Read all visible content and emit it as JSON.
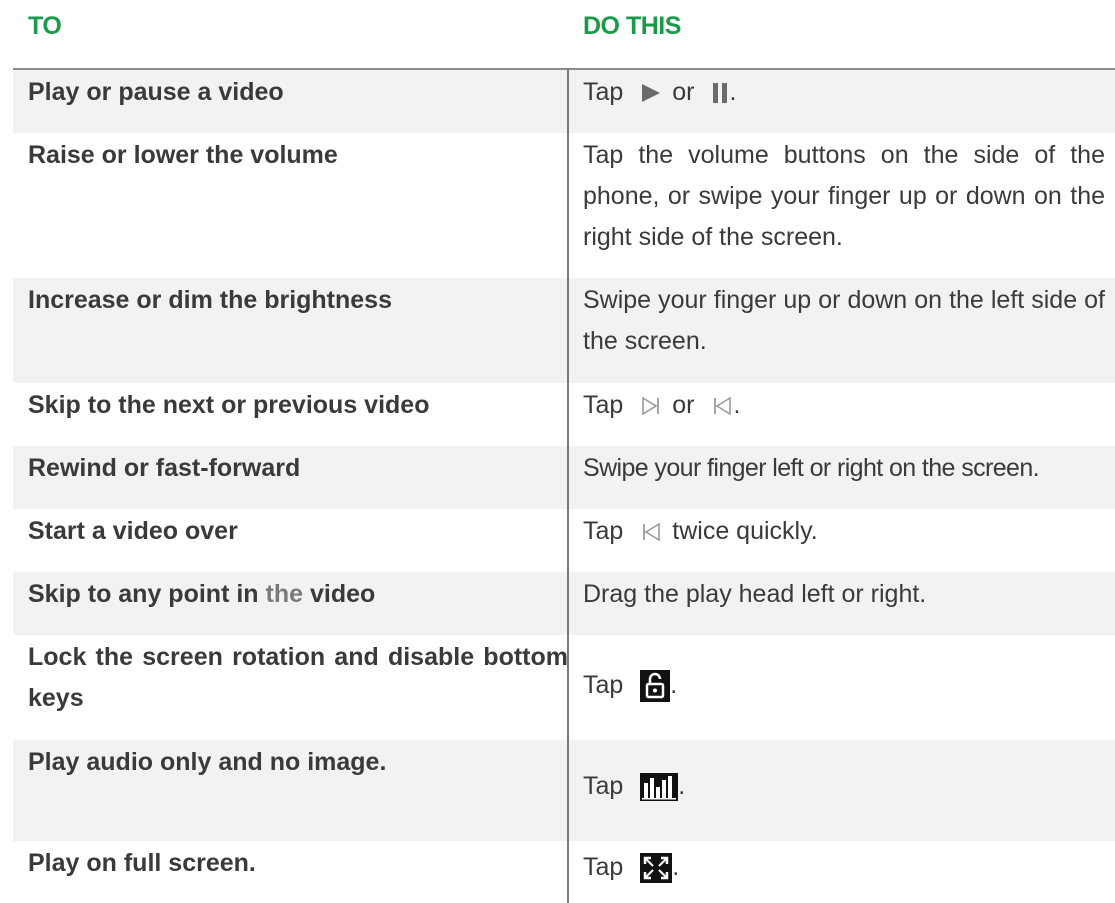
{
  "header": {
    "to": "TO",
    "do_this": "DO THIS",
    "color": "#1a9a4a"
  },
  "rows": [
    {
      "to": "Play or pause a video",
      "tap": "Tap",
      "mid": "or",
      "end": "."
    },
    {
      "to": "Raise or lower the volume",
      "do": "Tap the volume buttons on the side of the phone, or swipe your finger up or down on the right side of the screen."
    },
    {
      "to": "Increase or dim the brightness",
      "do": "Swipe your finger up or down on the left side of the screen."
    },
    {
      "to": "Skip to the next or previous video",
      "tap": "Tap",
      "mid": "or",
      "end": "."
    },
    {
      "to": "Rewind or fast-forward",
      "do": "Swipe your finger left or right on the screen."
    },
    {
      "to": "Start a video over",
      "tap": "Tap",
      "end": "twice quickly."
    },
    {
      "to_a": "Skip to any point in",
      "to_b": "the",
      "to_c": "video",
      "do": "Drag the play head left or right."
    },
    {
      "to": "Lock the screen rotation and disable bottom keys",
      "tap": "Tap",
      "end": "."
    },
    {
      "to": "Play audio only and no image.",
      "tap": "Tap",
      "end": "."
    },
    {
      "to": "Play on full screen.",
      "tap": "Tap",
      "end": "."
    }
  ],
  "icons": [
    "play-icon",
    "pause-icon",
    "next-icon",
    "previous-icon",
    "previous-icon",
    "lock-icon",
    "audio-icon",
    "fullscreen-icon"
  ]
}
